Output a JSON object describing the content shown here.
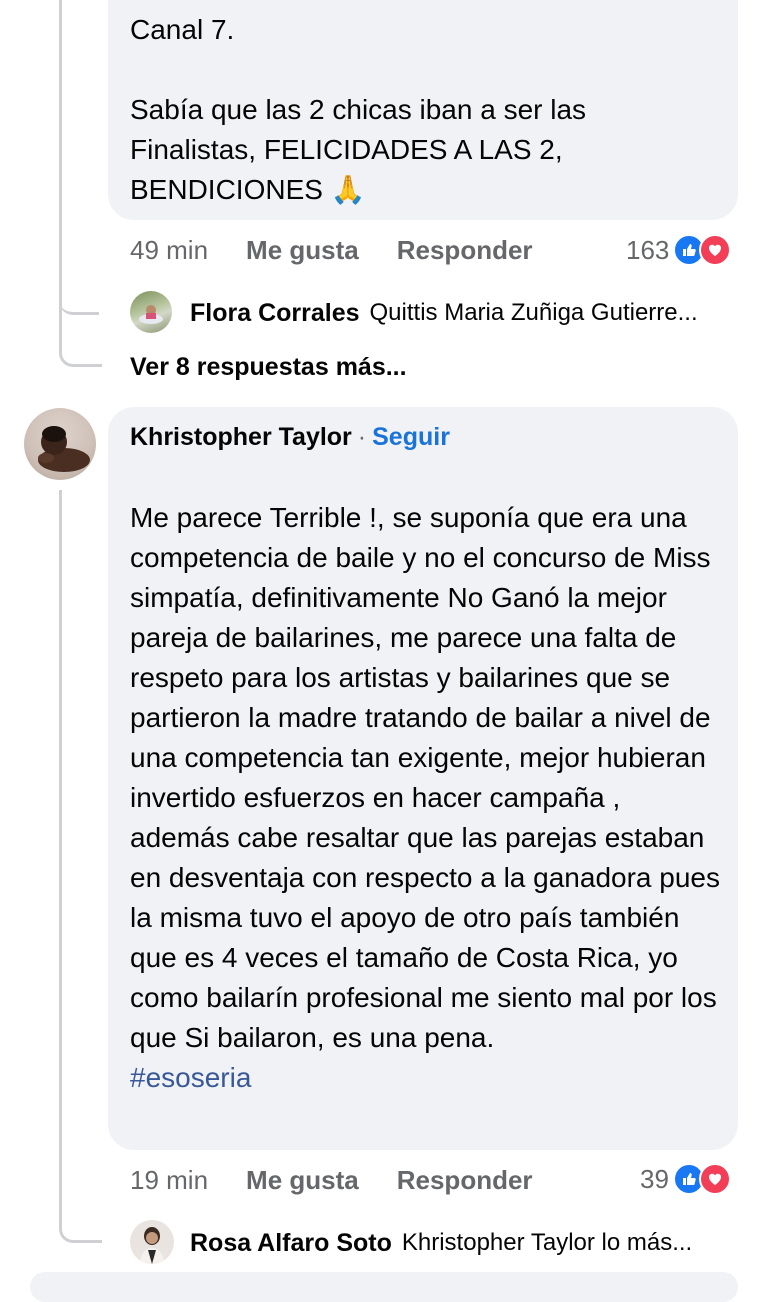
{
  "comment1": {
    "text": "Canal 7.\n\nSabía que las 2 chicas iban a ser las Finalistas, FELICIDADES A LAS 2, BENDICIONES 🙏",
    "time": "49 min",
    "like_label": "Me gusta",
    "reply_label": "Responder",
    "reaction_count": "163",
    "reply_preview": {
      "author": "Flora Corrales",
      "snippet": "Quittis Maria Zuñiga Gutierre..."
    },
    "more_replies": "Ver 8 respuestas más..."
  },
  "comment2": {
    "author": "Khristopher Taylor",
    "separator": "·",
    "follow_label": "Seguir",
    "text": "Me parece Terrible !,  se suponía que era una competencia de baile y no el concurso de Miss simpatía, definitivamente No Ganó la mejor pareja de bailarines, me parece una falta de respeto para los artistas y bailarines que se partieron la madre tratando de bailar a nivel de una competencia tan exigente, mejor hubieran invertido esfuerzos en hacer campaña  , además cabe resaltar que las parejas estaban en desventaja con respecto a la ganadora pues la misma tuvo el apoyo de otro país también que es 4 veces el tamaño de Costa Rica,  yo como bailarín profesional me siento mal por los que Si bailaron, es una pena.",
    "hashtag": "#esoseria",
    "time": "19 min",
    "like_label": "Me gusta",
    "reply_label": "Responder",
    "reaction_count": "39",
    "reply_preview": {
      "author": "Rosa Alfaro Soto",
      "snippet": "Khristopher Taylor lo más..."
    }
  },
  "icons": {
    "like": "like-reaction-icon",
    "love": "love-reaction-icon"
  },
  "colors": {
    "bubble": "#f0f2f5",
    "like": "#1877f2",
    "love": "#f33e58",
    "follow": "#1a73d8",
    "hashtag": "#385898",
    "meta": "#65676b"
  }
}
